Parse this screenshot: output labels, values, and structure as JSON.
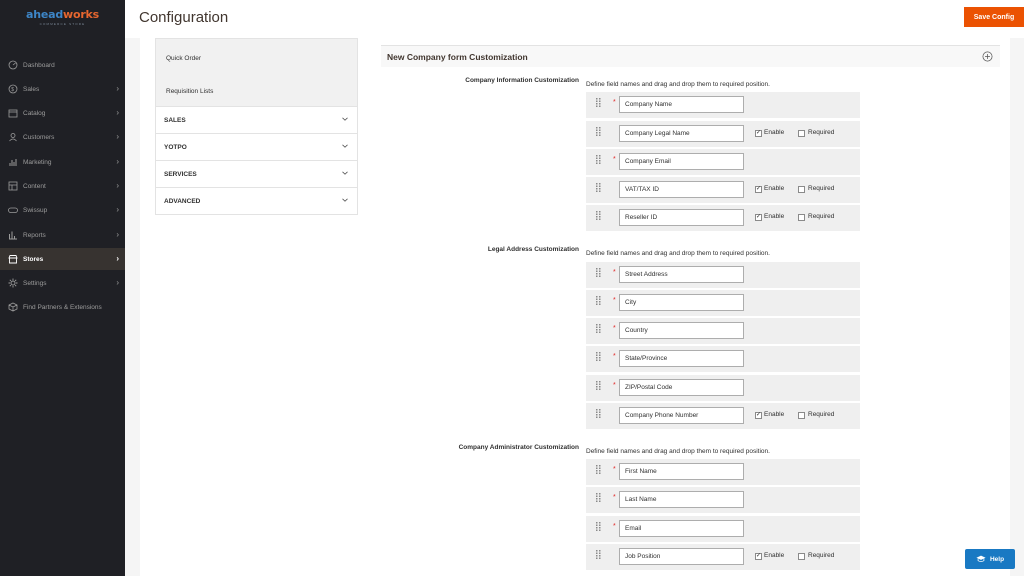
{
  "logo": {
    "main": "aheadworks",
    "sub": "COMMERCE STORE"
  },
  "sidebar": {
    "items": [
      {
        "label": "Dashboard",
        "icon": "dashboard-icon",
        "chevron": false,
        "active": false
      },
      {
        "label": "Sales",
        "icon": "dollar-icon",
        "chevron": true,
        "active": false
      },
      {
        "label": "Catalog",
        "icon": "box-icon",
        "chevron": true,
        "active": false
      },
      {
        "label": "Customers",
        "icon": "customers-icon",
        "chevron": true,
        "active": false
      },
      {
        "label": "Marketing",
        "icon": "chart-bars-icon",
        "chevron": true,
        "active": false
      },
      {
        "label": "Content",
        "icon": "layout-icon",
        "chevron": true,
        "active": false
      },
      {
        "label": "Swissup",
        "icon": "toggle-icon",
        "chevron": true,
        "active": false
      },
      {
        "label": "Reports",
        "icon": "reports-icon",
        "chevron": true,
        "active": false
      },
      {
        "label": "Stores",
        "icon": "store-icon",
        "chevron": true,
        "active": true
      },
      {
        "label": "Settings",
        "icon": "gear-icon",
        "chevron": true,
        "active": false
      },
      {
        "label": "Find Partners & Extensions",
        "icon": "cube-icon",
        "chevron": false,
        "active": false
      }
    ]
  },
  "header": {
    "title": "Configuration",
    "save_label": "Save Config"
  },
  "tabs": {
    "subitems": [
      "Quick Order",
      "Requisition Lists"
    ],
    "groups": [
      "SALES",
      "YOTPO",
      "SERVICES",
      "ADVANCED"
    ]
  },
  "section": {
    "title": "New Company form Customization"
  },
  "hint": "Define field names and drag and drop them to required position.",
  "enable_label": "Enable",
  "required_label": "Required",
  "groups": [
    {
      "label": "Company Information Customization",
      "fields": [
        {
          "value": "Company Name",
          "required": true,
          "options": false,
          "enabled": false
        },
        {
          "value": "Company Legal Name",
          "required": false,
          "options": true,
          "enabled": true
        },
        {
          "value": "Company Email",
          "required": true,
          "options": false,
          "enabled": false
        },
        {
          "value": "VAT/TAX ID",
          "required": false,
          "options": true,
          "enabled": true
        },
        {
          "value": "Reseller ID",
          "required": false,
          "options": true,
          "enabled": true
        }
      ]
    },
    {
      "label": "Legal Address Customization",
      "fields": [
        {
          "value": "Street Address",
          "required": true,
          "options": false,
          "enabled": false
        },
        {
          "value": "City",
          "required": true,
          "options": false,
          "enabled": false
        },
        {
          "value": "Country",
          "required": true,
          "options": false,
          "enabled": false
        },
        {
          "value": "State/Province",
          "required": true,
          "options": false,
          "enabled": false
        },
        {
          "value": "ZIP/Postal Code",
          "required": true,
          "options": false,
          "enabled": false
        },
        {
          "value": "Company Phone Number",
          "required": false,
          "options": true,
          "enabled": true
        }
      ]
    },
    {
      "label": "Company Administrator Customization",
      "fields": [
        {
          "value": "First Name",
          "required": true,
          "options": false,
          "enabled": false
        },
        {
          "value": "Last Name",
          "required": true,
          "options": false,
          "enabled": false
        },
        {
          "value": "Email",
          "required": true,
          "options": false,
          "enabled": false
        },
        {
          "value": "Job Position",
          "required": false,
          "options": true,
          "enabled": true
        }
      ]
    }
  ],
  "help_label": "Help",
  "colors": {
    "accent": "#eb5202",
    "sidebar": "#1f2025",
    "help": "#1979c3",
    "required": "#e22626"
  }
}
